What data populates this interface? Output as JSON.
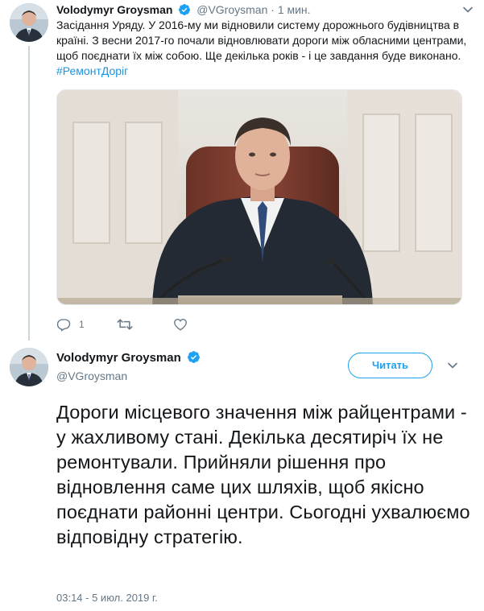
{
  "colors": {
    "text": "#14171a",
    "secondary": "#657786",
    "link": "#1b95e0",
    "accent": "#1da1f2",
    "thread_line": "#ccd6dd"
  },
  "parent_tweet": {
    "author_name": "Volodymyr Groysman",
    "handle": "@VGroysman",
    "separator": "·",
    "time": "1 мин.",
    "text": "Засідання Уряду. У 2016-му ми відновили систему дорожнього будівництва в країні. З весни 2017-го почали відновлювати дороги між обласними центрами, щоб поєднати їх між собою. Ще декілька років - і це завдання буде виконано. ",
    "hashtag": "#РемонтДоріг",
    "media_icon": "photo-of-speaker-at-microphones",
    "actions": {
      "reply_count": "1",
      "retweet_count": "",
      "like_count": ""
    },
    "icons": {
      "reply": "reply-icon",
      "retweet": "retweet-icon",
      "like": "heart-icon",
      "menu": "chevron-down-icon",
      "verified": "verified-badge-icon"
    }
  },
  "main_tweet": {
    "author_name": "Volodymyr Groysman",
    "handle": "@VGroysman",
    "follow_label": "Читать",
    "text": "Дороги місцевого значення між райцентрами - у жахливому стані. Декілька десятиріч їх не ремонтували. Прийняли рішення про відновлення саме цих шляхів, щоб якісно поєднати районні центри. Сьогодні ухвалюємо відповідну стратегію.",
    "timestamp": "03:14 - 5 июл. 2019 г."
  }
}
